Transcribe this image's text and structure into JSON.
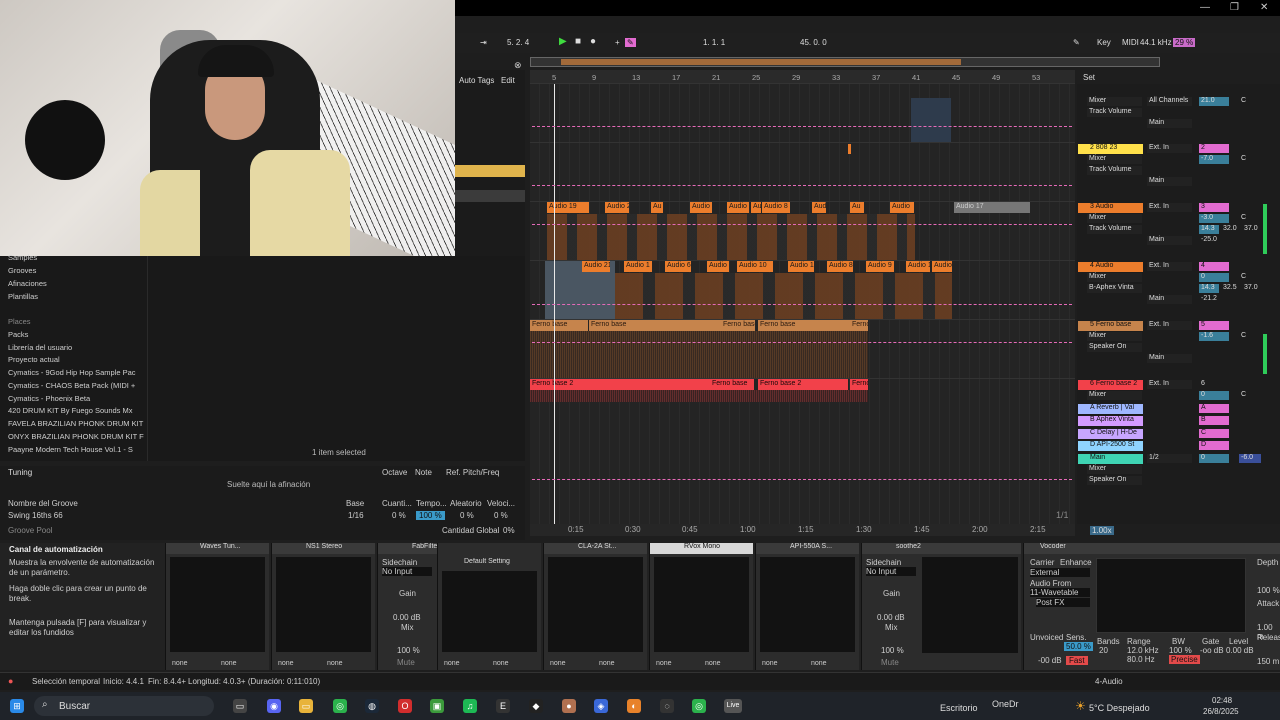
{
  "transport": {
    "quantize": "5. 2. 4",
    "position": "1. 1. 1",
    "tempo": "45. 0. 0",
    "key": "Key",
    "midi": "MIDI",
    "sample_rate": "44.1 kHz",
    "cpu": "29 %"
  },
  "ruler": [
    "5",
    "9",
    "13",
    "17",
    "21",
    "25",
    "29",
    "33",
    "37",
    "41",
    "45",
    "49",
    "53"
  ],
  "browser": {
    "auto_tags": "Auto Tags",
    "edit": "Edit",
    "top_items": [
      "Samples",
      "Grooves",
      "Afinaciones",
      "Plantillas"
    ],
    "places_head": "Places",
    "places": [
      "Packs",
      "Librería del usuario",
      "Proyecto actual",
      "Cymatics - 9God Hip Hop Sample Pac",
      "Cymatics - CHAOS Beta Pack (MIDI +",
      "Cymatics - Phoenix Beta",
      "420 DRUM KIT By Fuego Sounds Mx",
      "FAVELA BRAZILIAN PHONK DRUM KIT",
      "ONYX BRAZILIAN PHONK DRUM KIT F",
      "Paayne Modern Tech House Vol.1 - S"
    ],
    "selected": "1 item selected"
  },
  "tuning": {
    "title": "Tuning",
    "cols": [
      "Octave",
      "Note",
      "Ref. Pitch/Freq"
    ],
    "drop": "Suelte aquí la afinación"
  },
  "groove": {
    "cols": [
      "Nombre del Groove",
      "Base",
      "Cuanti...",
      "Tempo...",
      "Aleatorio",
      "Veloci..."
    ],
    "name": "Swing 16ths 66",
    "base": "1/16",
    "quant": "0 %",
    "tempo": "100 %",
    "random": "0 %",
    "vel": "0 %",
    "pool": "Groove Pool",
    "global_label": "Cantidad Global",
    "global": "0%"
  },
  "clips": {
    "audio_row": [
      "Audio 19",
      "Audio 2",
      "Au",
      "Audio",
      "Audio",
      "Au",
      "Audio 8",
      "Audio",
      "Au",
      "Audio",
      "Audio 17"
    ],
    "audio_row2": [
      "Audio 21",
      "Audio 1",
      "Audio 6",
      "Audio",
      "Audio 10",
      "Audio 1",
      "Audio 8",
      "Audio 9",
      "Audio 1",
      "Audio"
    ],
    "ferno": [
      "Ferno base",
      "Ferno base",
      "Ferno base",
      "Ferno base",
      "Ferno base",
      "Ferno"
    ],
    "ferno2": [
      "Ferno base 2",
      "Ferno base",
      "Ferno base 2",
      "Ferno"
    ]
  },
  "timeline": [
    "0:15",
    "0:30",
    "0:45",
    "1:00",
    "1:15",
    "1:30",
    "1:45",
    "2:00",
    "2:15"
  ],
  "page": "1/1",
  "zoom": "1.00x",
  "set": "Set",
  "mixer": {
    "t1": {
      "a": "Mixer",
      "b": "Track Volume",
      "c": "Main",
      "in": "All Channels",
      "vol": "21.0",
      "pan": "C"
    },
    "t2": {
      "name": "2 808 23",
      "a": "Mixer",
      "b": "Track Volume",
      "c": "Main",
      "in": "Ext. In",
      "num": "2",
      "vol": "-7.0",
      "pan": "C"
    },
    "t3": {
      "name": "3 Audio",
      "a": "Mixer",
      "b": "Track Volume",
      "c": "Main",
      "in": "Ext. In",
      "num": "3",
      "vol": "-3.0",
      "pan": "C",
      "x1": "14.3",
      "x2": "32.0",
      "x3": "37.0",
      "x4": "-25.0"
    },
    "t4": {
      "name": "4 Audio",
      "a": "Mixer",
      "b": "B-Aphex Vinta",
      "c": "Main",
      "in": "Ext. In",
      "num": "4",
      "vol": "0",
      "pan": "C",
      "x1": "14.3",
      "x2": "32.5",
      "x3": "37.0",
      "x4": "-21.2"
    },
    "t5": {
      "name": "5 Ferno base",
      "a": "Mixer",
      "b": "Speaker On",
      "c": "Main",
      "in": "Ext. In",
      "num": "5",
      "vol": "-1.6",
      "pan": "C"
    },
    "t6": {
      "name": "6 Ferno base 2",
      "a": "Mixer",
      "in": "Ext. In",
      "num": "6",
      "vol": "0",
      "pan": "C"
    },
    "returns": [
      {
        "name": "A Reverb | Val",
        "l": "A",
        "color": "#9fb7ff"
      },
      {
        "name": "B Aphex Vinta",
        "l": "B",
        "color": "#d39bff"
      },
      {
        "name": "C Delay | H-De",
        "l": "C",
        "color": "#c7a6ff"
      },
      {
        "name": "D API-2500 St",
        "l": "D",
        "color": "#8fd4ff"
      }
    ],
    "main": {
      "name": "Main",
      "a": "Mixer",
      "b": "Speaker On",
      "in": "1/2",
      "vol": "0",
      "pan": "-6.0"
    }
  },
  "auto_panel": {
    "title": "Canal de automatización",
    "p1": "Muestra la envolvente de automatización de un parámetro.",
    "p2": "Haga doble clic para crear un punto de break.",
    "p3": "Mantenga pulsada [F] para visualizar y editar los fundidos"
  },
  "devices": [
    {
      "name": "Waves Tun...",
      "foot1": "none",
      "foot2": "none"
    },
    {
      "name": "NS1 Stereo",
      "foot1": "none",
      "foot2": "none"
    },
    {
      "name": "FabFilter Pro-Q 3",
      "side": "Sidechain",
      "input": "No Input",
      "gain": "Gain",
      "db": "0.00 dB",
      "mix": "Mix",
      "pct": "100 %",
      "mute": "Mute"
    },
    {
      "name": "Default Setting",
      "foot1": "none",
      "foot2": "none"
    },
    {
      "name": "CLA-2A St...",
      "foot1": "none",
      "foot2": "none"
    },
    {
      "name": "RVox Mono",
      "foot1": "none",
      "foot2": "none"
    },
    {
      "name": "API-550A S...",
      "foot1": "none",
      "foot2": "none"
    },
    {
      "name": "soothe2",
      "side": "Sidechain",
      "input": "No Input",
      "gain": "Gain",
      "db": "0.00 dB",
      "mix": "Mix",
      "pct": "100 %",
      "mute": "Mute"
    }
  ],
  "vocoder": {
    "title": "Vocoder",
    "carrier": "Carrier",
    "enhance": "Enhance",
    "external": "External",
    "from": "Audio From",
    "src": "11-Wavetable",
    "post": "Post FX",
    "unvoiced": "Unvoiced",
    "sens": "Sens.",
    "sens_val": "50.0 %",
    "db": "-00 dB",
    "fast": "Fast",
    "bands_l": "Bands",
    "bands": "20",
    "range_l": "Range",
    "range1": "12.0 kHz",
    "range2": "80.0 Hz",
    "bw_l": "BW",
    "bw": "100 %",
    "precise": "Precise",
    "gate_l": "Gate",
    "gate": "-oo dB",
    "level_l": "Level",
    "level": "0.00 dB",
    "depth": "Depth",
    "depth_val": "100 %",
    "attack": "Attack",
    "atk_val": "1.00 m",
    "release": "Release",
    "rel_val": "150 m"
  },
  "status": {
    "sel": "Selección temporal",
    "start": "Inicio: 4.4.1",
    "end": "Fin: 8.4.4+",
    "len": "Longitud: 4.0.3+ (Duración: 0:11:010)",
    "track": "4-Audio"
  },
  "taskbar": {
    "search": "Buscar",
    "desk": "Escritorio",
    "onedrive": "OneDr",
    "weather": "5°C  Despejado",
    "time": "02:48",
    "date": "26/8/2025"
  }
}
